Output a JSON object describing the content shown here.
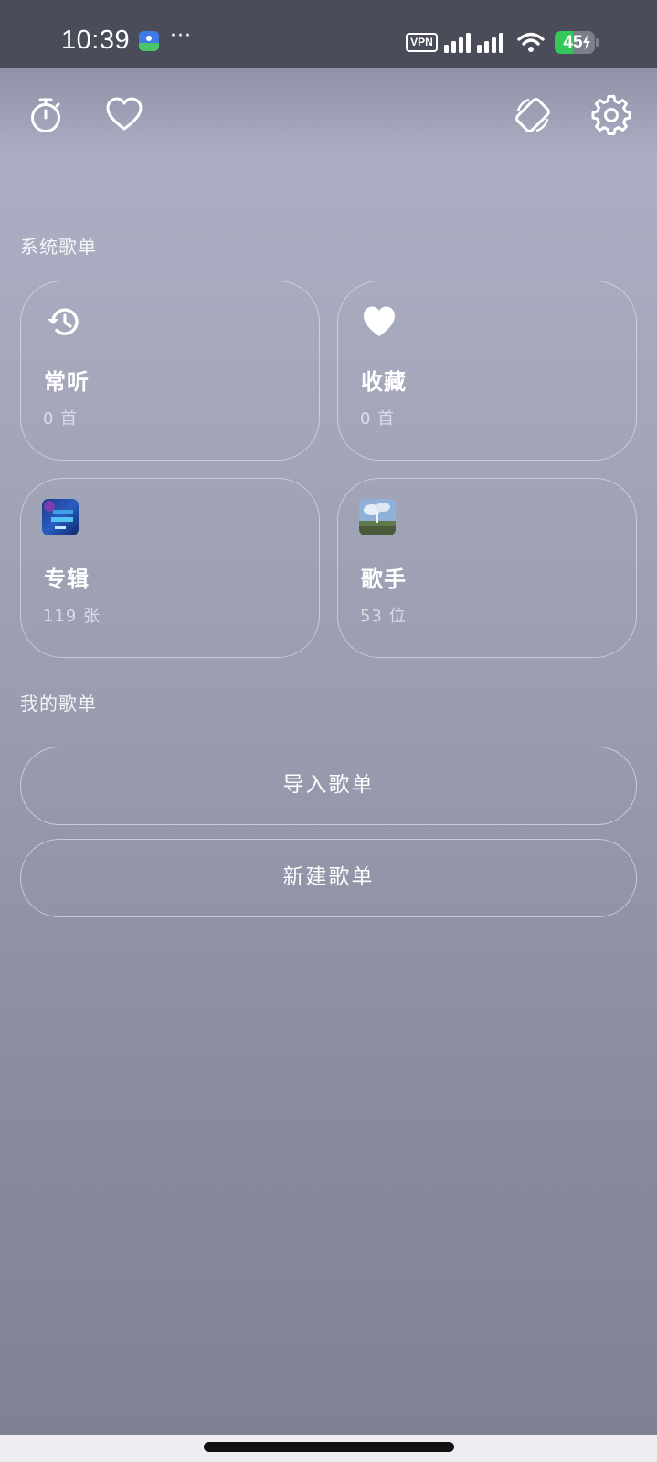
{
  "status_bar": {
    "time": "10:39",
    "more": "···",
    "vpn": "VPN",
    "battery_percent": "45",
    "battery_level": 0.45,
    "battery_charging": true
  },
  "toolbar": {
    "icons": [
      "timer-icon",
      "heart-outline-icon",
      "screen-rotation-icon",
      "gear-icon"
    ]
  },
  "system_playlists": {
    "title": "系统歌单",
    "cards": [
      {
        "name": "常听",
        "count": "0 首",
        "icon": "history-icon"
      },
      {
        "name": "收藏",
        "count": "0 首",
        "icon": "heart-filled-icon"
      },
      {
        "name": "专辑",
        "count": "119 张",
        "icon": "album-thumbnail"
      },
      {
        "name": "歌手",
        "count": "53 位",
        "icon": "artist-thumbnail"
      }
    ]
  },
  "my_playlists": {
    "title": "我的歌单",
    "import_label": "导入歌单",
    "create_label": "新建歌单"
  },
  "colors": {
    "status_bar_bg": "#4a4c5a",
    "battery_green": "#34c759",
    "card_border": "rgba(255,255,255,0.45)"
  }
}
